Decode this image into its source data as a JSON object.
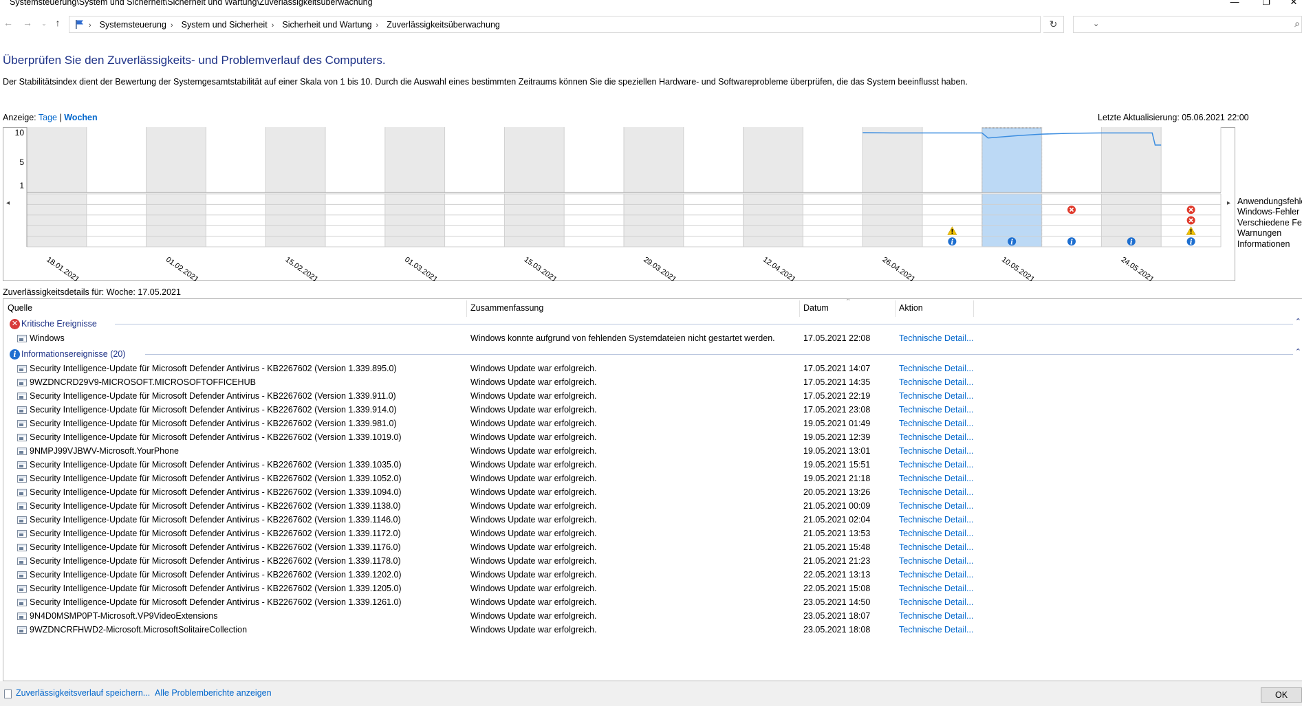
{
  "window": {
    "title": "Systemsteuerung\\System und Sicherheit\\Sicherheit und Wartung\\Zuverlässigkeitsüberwachung",
    "minimize_glyph": "—",
    "maximize_glyph": "❐",
    "close_glyph": "✕"
  },
  "address_bar": {
    "breadcrumbs": [
      "Systemsteuerung",
      "System und Sicherheit",
      "Sicherheit und Wartung",
      "Zuverlässigkeitsüberwachung"
    ],
    "search_placeholder": ""
  },
  "page": {
    "headline": "Überprüfen Sie den Zuverlässigkeits- und Problemverlauf des Computers.",
    "description": "Der Stabilitätsindex dient der Bewertung der Systemgesamtstabilität auf einer Skala von 1 bis 10. Durch die Auswahl eines bestimmten Zeitraums können Sie die speziellen Hardware- und Softwareprobleme überprüfen, die das System beeinflusst haben.",
    "view_label": "Anzeige:",
    "view_days": "Tage",
    "view_separator": "|",
    "view_weeks": "Wochen",
    "last_update": "Letzte Aktualisierung: 05.06.2021 22:00"
  },
  "chart_data": {
    "type": "line",
    "title": "",
    "y_ticks": [
      "10",
      "5",
      "1"
    ],
    "ylim": [
      1,
      10
    ],
    "x_tick_labels": [
      "18.01.2021",
      "01.02.2021",
      "15.02.2021",
      "01.03.2021",
      "15.03.2021",
      "29.03.2021",
      "12.04.2021",
      "26.04.2021",
      "10.05.2021",
      "24.05.2021"
    ],
    "week_count": 20,
    "selected_week": 17,
    "stability_index": [
      {
        "week": 15.0,
        "value": 10.0
      },
      {
        "week": 15.5,
        "value": 9.95
      },
      {
        "week": 16.0,
        "value": 9.95
      },
      {
        "week": 17.0,
        "value": 9.95
      },
      {
        "week": 17.1,
        "value": 9.1
      },
      {
        "week": 17.6,
        "value": 9.5
      },
      {
        "week": 18.0,
        "value": 9.75
      },
      {
        "week": 18.5,
        "value": 9.9
      },
      {
        "week": 19.0,
        "value": 9.95
      },
      {
        "week": 19.85,
        "value": 9.95
      },
      {
        "week": 19.9,
        "value": 7.9
      },
      {
        "week": 20.0,
        "value": 7.9
      }
    ],
    "categories": [
      "Anwendungsfehler",
      "Windows-Fehler",
      "Verschiedene Fehler",
      "Warnungen",
      "Informationen"
    ],
    "events": [
      {
        "week": 16,
        "category": "Warnungen",
        "kind": "warning"
      },
      {
        "week": 16,
        "category": "Informationen",
        "kind": "info"
      },
      {
        "week": 17,
        "category": "Informationen",
        "kind": "info"
      },
      {
        "week": 18,
        "category": "Windows-Fehler",
        "kind": "error"
      },
      {
        "week": 18,
        "category": "Informationen",
        "kind": "info"
      },
      {
        "week": 19,
        "category": "Informationen",
        "kind": "info"
      },
      {
        "week": 20,
        "category": "Windows-Fehler",
        "kind": "error"
      },
      {
        "week": 20,
        "category": "Verschiedene Fehler",
        "kind": "error"
      },
      {
        "week": 20,
        "category": "Warnungen",
        "kind": "warning"
      },
      {
        "week": 20,
        "category": "Informationen",
        "kind": "info"
      }
    ],
    "colors": {
      "line": "#3b8de0",
      "selection": "#bcd9f5",
      "shade": "#e9e9e9",
      "error": "#e0392b",
      "warning": "#f2c200",
      "info": "#1e6fd0"
    }
  },
  "details": {
    "label": "Zuverlässigkeitsdetails für: Woche: 17.05.2021",
    "columns": {
      "source": "Quelle",
      "summary": "Zusammenfassung",
      "date": "Datum",
      "action": "Aktion"
    },
    "critical": {
      "title": "Kritische Ereignisse",
      "rows": [
        {
          "source": "Windows",
          "summary": "Windows konnte aufgrund von fehlenden Systemdateien nicht gestartet werden.",
          "date": "17.05.2021 22:08",
          "action": "Technische Detail..."
        }
      ]
    },
    "info": {
      "title": "Informationsereignisse (20)",
      "rows": [
        {
          "source": "Security Intelligence-Update für Microsoft Defender Antivirus - KB2267602 (Version 1.339.895.0)",
          "summary": "Windows Update war erfolgreich.",
          "date": "17.05.2021 14:07",
          "action": "Technische Detail..."
        },
        {
          "source": "9WZDNCRD29V9-MICROSOFT.MICROSOFTOFFICEHUB",
          "summary": "Windows Update war erfolgreich.",
          "date": "17.05.2021 14:35",
          "action": "Technische Detail..."
        },
        {
          "source": "Security Intelligence-Update für Microsoft Defender Antivirus - KB2267602 (Version 1.339.911.0)",
          "summary": "Windows Update war erfolgreich.",
          "date": "17.05.2021 22:19",
          "action": "Technische Detail..."
        },
        {
          "source": "Security Intelligence-Update für Microsoft Defender Antivirus - KB2267602 (Version 1.339.914.0)",
          "summary": "Windows Update war erfolgreich.",
          "date": "17.05.2021 23:08",
          "action": "Technische Detail..."
        },
        {
          "source": "Security Intelligence-Update für Microsoft Defender Antivirus - KB2267602 (Version 1.339.981.0)",
          "summary": "Windows Update war erfolgreich.",
          "date": "19.05.2021 01:49",
          "action": "Technische Detail..."
        },
        {
          "source": "Security Intelligence-Update für Microsoft Defender Antivirus - KB2267602 (Version 1.339.1019.0)",
          "summary": "Windows Update war erfolgreich.",
          "date": "19.05.2021 12:39",
          "action": "Technische Detail..."
        },
        {
          "source": "9NMPJ99VJBWV-Microsoft.YourPhone",
          "summary": "Windows Update war erfolgreich.",
          "date": "19.05.2021 13:01",
          "action": "Technische Detail..."
        },
        {
          "source": "Security Intelligence-Update für Microsoft Defender Antivirus - KB2267602 (Version 1.339.1035.0)",
          "summary": "Windows Update war erfolgreich.",
          "date": "19.05.2021 15:51",
          "action": "Technische Detail..."
        },
        {
          "source": "Security Intelligence-Update für Microsoft Defender Antivirus - KB2267602 (Version 1.339.1052.0)",
          "summary": "Windows Update war erfolgreich.",
          "date": "19.05.2021 21:18",
          "action": "Technische Detail..."
        },
        {
          "source": "Security Intelligence-Update für Microsoft Defender Antivirus - KB2267602 (Version 1.339.1094.0)",
          "summary": "Windows Update war erfolgreich.",
          "date": "20.05.2021 13:26",
          "action": "Technische Detail..."
        },
        {
          "source": "Security Intelligence-Update für Microsoft Defender Antivirus - KB2267602 (Version 1.339.1138.0)",
          "summary": "Windows Update war erfolgreich.",
          "date": "21.05.2021 00:09",
          "action": "Technische Detail..."
        },
        {
          "source": "Security Intelligence-Update für Microsoft Defender Antivirus - KB2267602 (Version 1.339.1146.0)",
          "summary": "Windows Update war erfolgreich.",
          "date": "21.05.2021 02:04",
          "action": "Technische Detail..."
        },
        {
          "source": "Security Intelligence-Update für Microsoft Defender Antivirus - KB2267602 (Version 1.339.1172.0)",
          "summary": "Windows Update war erfolgreich.",
          "date": "21.05.2021 13:53",
          "action": "Technische Detail..."
        },
        {
          "source": "Security Intelligence-Update für Microsoft Defender Antivirus - KB2267602 (Version 1.339.1176.0)",
          "summary": "Windows Update war erfolgreich.",
          "date": "21.05.2021 15:48",
          "action": "Technische Detail..."
        },
        {
          "source": "Security Intelligence-Update für Microsoft Defender Antivirus - KB2267602 (Version 1.339.1178.0)",
          "summary": "Windows Update war erfolgreich.",
          "date": "21.05.2021 21:23",
          "action": "Technische Detail..."
        },
        {
          "source": "Security Intelligence-Update für Microsoft Defender Antivirus - KB2267602 (Version 1.339.1202.0)",
          "summary": "Windows Update war erfolgreich.",
          "date": "22.05.2021 13:13",
          "action": "Technische Detail..."
        },
        {
          "source": "Security Intelligence-Update für Microsoft Defender Antivirus - KB2267602 (Version 1.339.1205.0)",
          "summary": "Windows Update war erfolgreich.",
          "date": "22.05.2021 15:08",
          "action": "Technische Detail..."
        },
        {
          "source": "Security Intelligence-Update für Microsoft Defender Antivirus - KB2267602 (Version 1.339.1261.0)",
          "summary": "Windows Update war erfolgreich.",
          "date": "23.05.2021 14:50",
          "action": "Technische Detail..."
        },
        {
          "source": "9N4D0MSMP0PT-Microsoft.VP9VideoExtensions",
          "summary": "Windows Update war erfolgreich.",
          "date": "23.05.2021 18:07",
          "action": "Technische Detail..."
        },
        {
          "source": "9WZDNCRFHWD2-Microsoft.MicrosoftSolitaireCollection",
          "summary": "Windows Update war erfolgreich.",
          "date": "23.05.2021 18:08",
          "action": "Technische Detail..."
        }
      ]
    }
  },
  "footer": {
    "save_history": "Zuverlässigkeitsverlauf speichern...",
    "all_reports": "Alle Problemberichte anzeigen",
    "ok": "OK"
  }
}
